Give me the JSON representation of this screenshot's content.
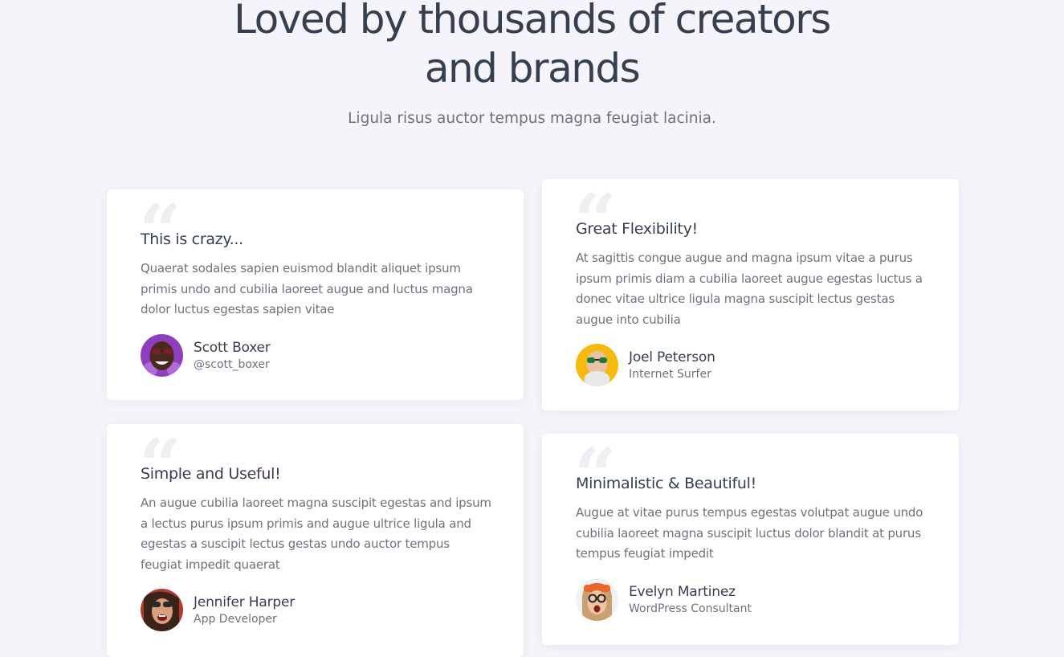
{
  "header": {
    "title_line1": "Loved by thousands of creators",
    "title_line2": "and brands",
    "subtitle": "Ligula risus auctor tempus magna feugiat lacinia."
  },
  "testimonials": [
    {
      "quote_glyph": "“",
      "title": "This is crazy...",
      "text": "Quaerat sodales sapien euismod blandit aliquet ipsum primis undo and cubilia laoreet augue and luctus magna dolor luctus egestas sapien vitae",
      "author_name": "Scott Boxer",
      "author_role": "@scott_boxer",
      "avatar_bg": "#8e3fbf"
    },
    {
      "quote_glyph": "“",
      "title": "Great Flexibility!",
      "text": "At sagittis congue augue and magna ipsum vitae a purus ipsum primis diam a cubilia laoreet augue egestas luctus a donec vitae ultrice ligula magna suscipit lectus gestas augue into cubilia",
      "author_name": "Joel Peterson",
      "author_role": "Internet Surfer",
      "avatar_bg": "#f6b90f"
    },
    {
      "quote_glyph": "“",
      "title": "Simple and Useful!",
      "text": "An augue cubilia laoreet magna suscipit egestas and ipsum a lectus purus ipsum primis and augue ultrice ligula and egestas a suscipit lectus gestas undo auctor tempus feugiat impedit quaerat",
      "author_name": "Jennifer Harper",
      "author_role": "App Developer",
      "avatar_bg": "#b33a2c"
    },
    {
      "quote_glyph": "“",
      "title": "Minimalistic & Beautiful!",
      "text": "Augue at vitae purus tempus egestas volutpat augue undo cubilia laoreet magna suscipit luctus dolor blandit at purus tempus feugiat impedit",
      "author_name": "Evelyn Martinez",
      "author_role": "WordPress Consultant",
      "avatar_bg": "#f2f2f2"
    }
  ]
}
